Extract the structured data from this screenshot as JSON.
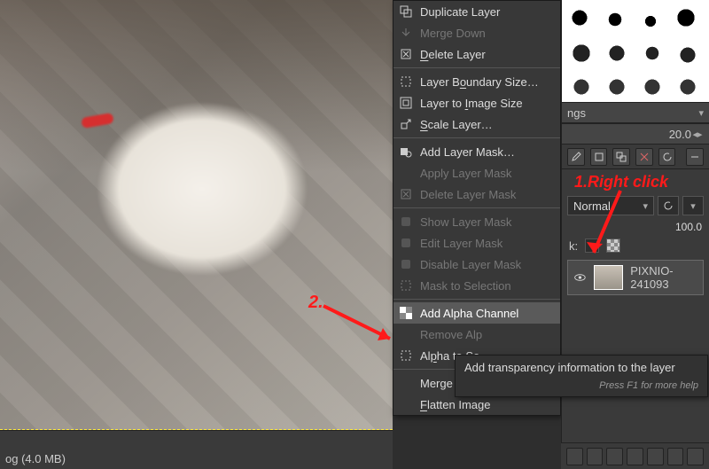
{
  "canvas": {
    "status_text": "og (4.0 MB)"
  },
  "context_menu": {
    "duplicate_layer": "Duplicate Layer",
    "merge_down": "Merge Down",
    "delete_layer": "Delete Layer",
    "layer_boundary_size": "Layer Boundary Size…",
    "layer_to_image_size": "Layer to Image Size",
    "scale_layer": "Scale Layer…",
    "add_layer_mask": "Add Layer Mask…",
    "apply_layer_mask": "Apply Layer Mask",
    "delete_layer_mask": "Delete Layer Mask",
    "show_layer_mask": "Show Layer Mask",
    "edit_layer_mask": "Edit Layer Mask",
    "disable_layer_mask": "Disable Layer Mask",
    "mask_to_selection": "Mask to Selection",
    "add_alpha_channel": "Add Alpha Channel",
    "remove_alpha_channel_short": "Remove Alp",
    "alpha_to_selection_short": "Alpha to Se",
    "merge_visible_layers": "Merge Visible Layers…",
    "flatten_image": "Flatten Image"
  },
  "right_panel": {
    "dropdown_label": "ngs",
    "spacing_value": "20.0",
    "blend_mode": "Normal",
    "opacity_value": "100.0",
    "lock_label": "k:",
    "layer_name": "PIXNIO-241093"
  },
  "tooltip": {
    "text": "Add transparency information to the layer",
    "hint": "Press F1 for more help"
  },
  "annotations": {
    "step1": "1.Right click",
    "step2": "2."
  }
}
